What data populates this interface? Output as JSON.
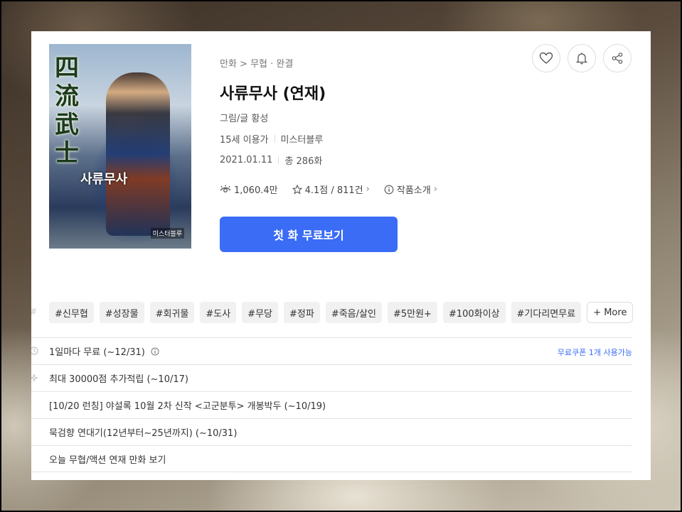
{
  "cover": {
    "title_chars": "四流武士",
    "badge": "사류무사",
    "publisher": "미스터블루"
  },
  "breadcrumb": "만화 > 무협 · 완결",
  "title": "사류무사 (연재)",
  "author": "그림/글 황성",
  "age_rating": "15세 이용가",
  "publisher": "미스터블루",
  "date": "2021.01.11",
  "episodes": "총 286화",
  "stats": {
    "views": "1,060.4만",
    "rating": "4.1점 / 811건",
    "intro": "작품소개"
  },
  "cta_label": "첫 화 무료보기",
  "top_icons": [
    "heart-icon",
    "bell-icon",
    "share-icon"
  ],
  "tags": [
    "#신무협",
    "#성장물",
    "#회귀물",
    "#도사",
    "#무당",
    "#정파",
    "#죽음/살인",
    "#5만원+",
    "#100화이상",
    "#기다리면무료"
  ],
  "tag_more": "+ More",
  "notices": [
    {
      "text": "1일마다 무료 (~12/31)",
      "right": "무료쿠폰 1개 사용가능"
    },
    {
      "text": "최대 30000점 추가적립 (~10/17)"
    },
    {
      "text": "[10/20 런칭] 야설록 10월 2차 신작 <고군분투> 개봉박두 (~10/19)"
    },
    {
      "text": "묵검향 연대기(12년부터~25년까지) (~10/31)"
    },
    {
      "text": "오늘 무협/액션 연재 만화 보기"
    }
  ],
  "colors": {
    "accent": "#3a6cf6",
    "tag_bg": "#f1f1f1"
  }
}
